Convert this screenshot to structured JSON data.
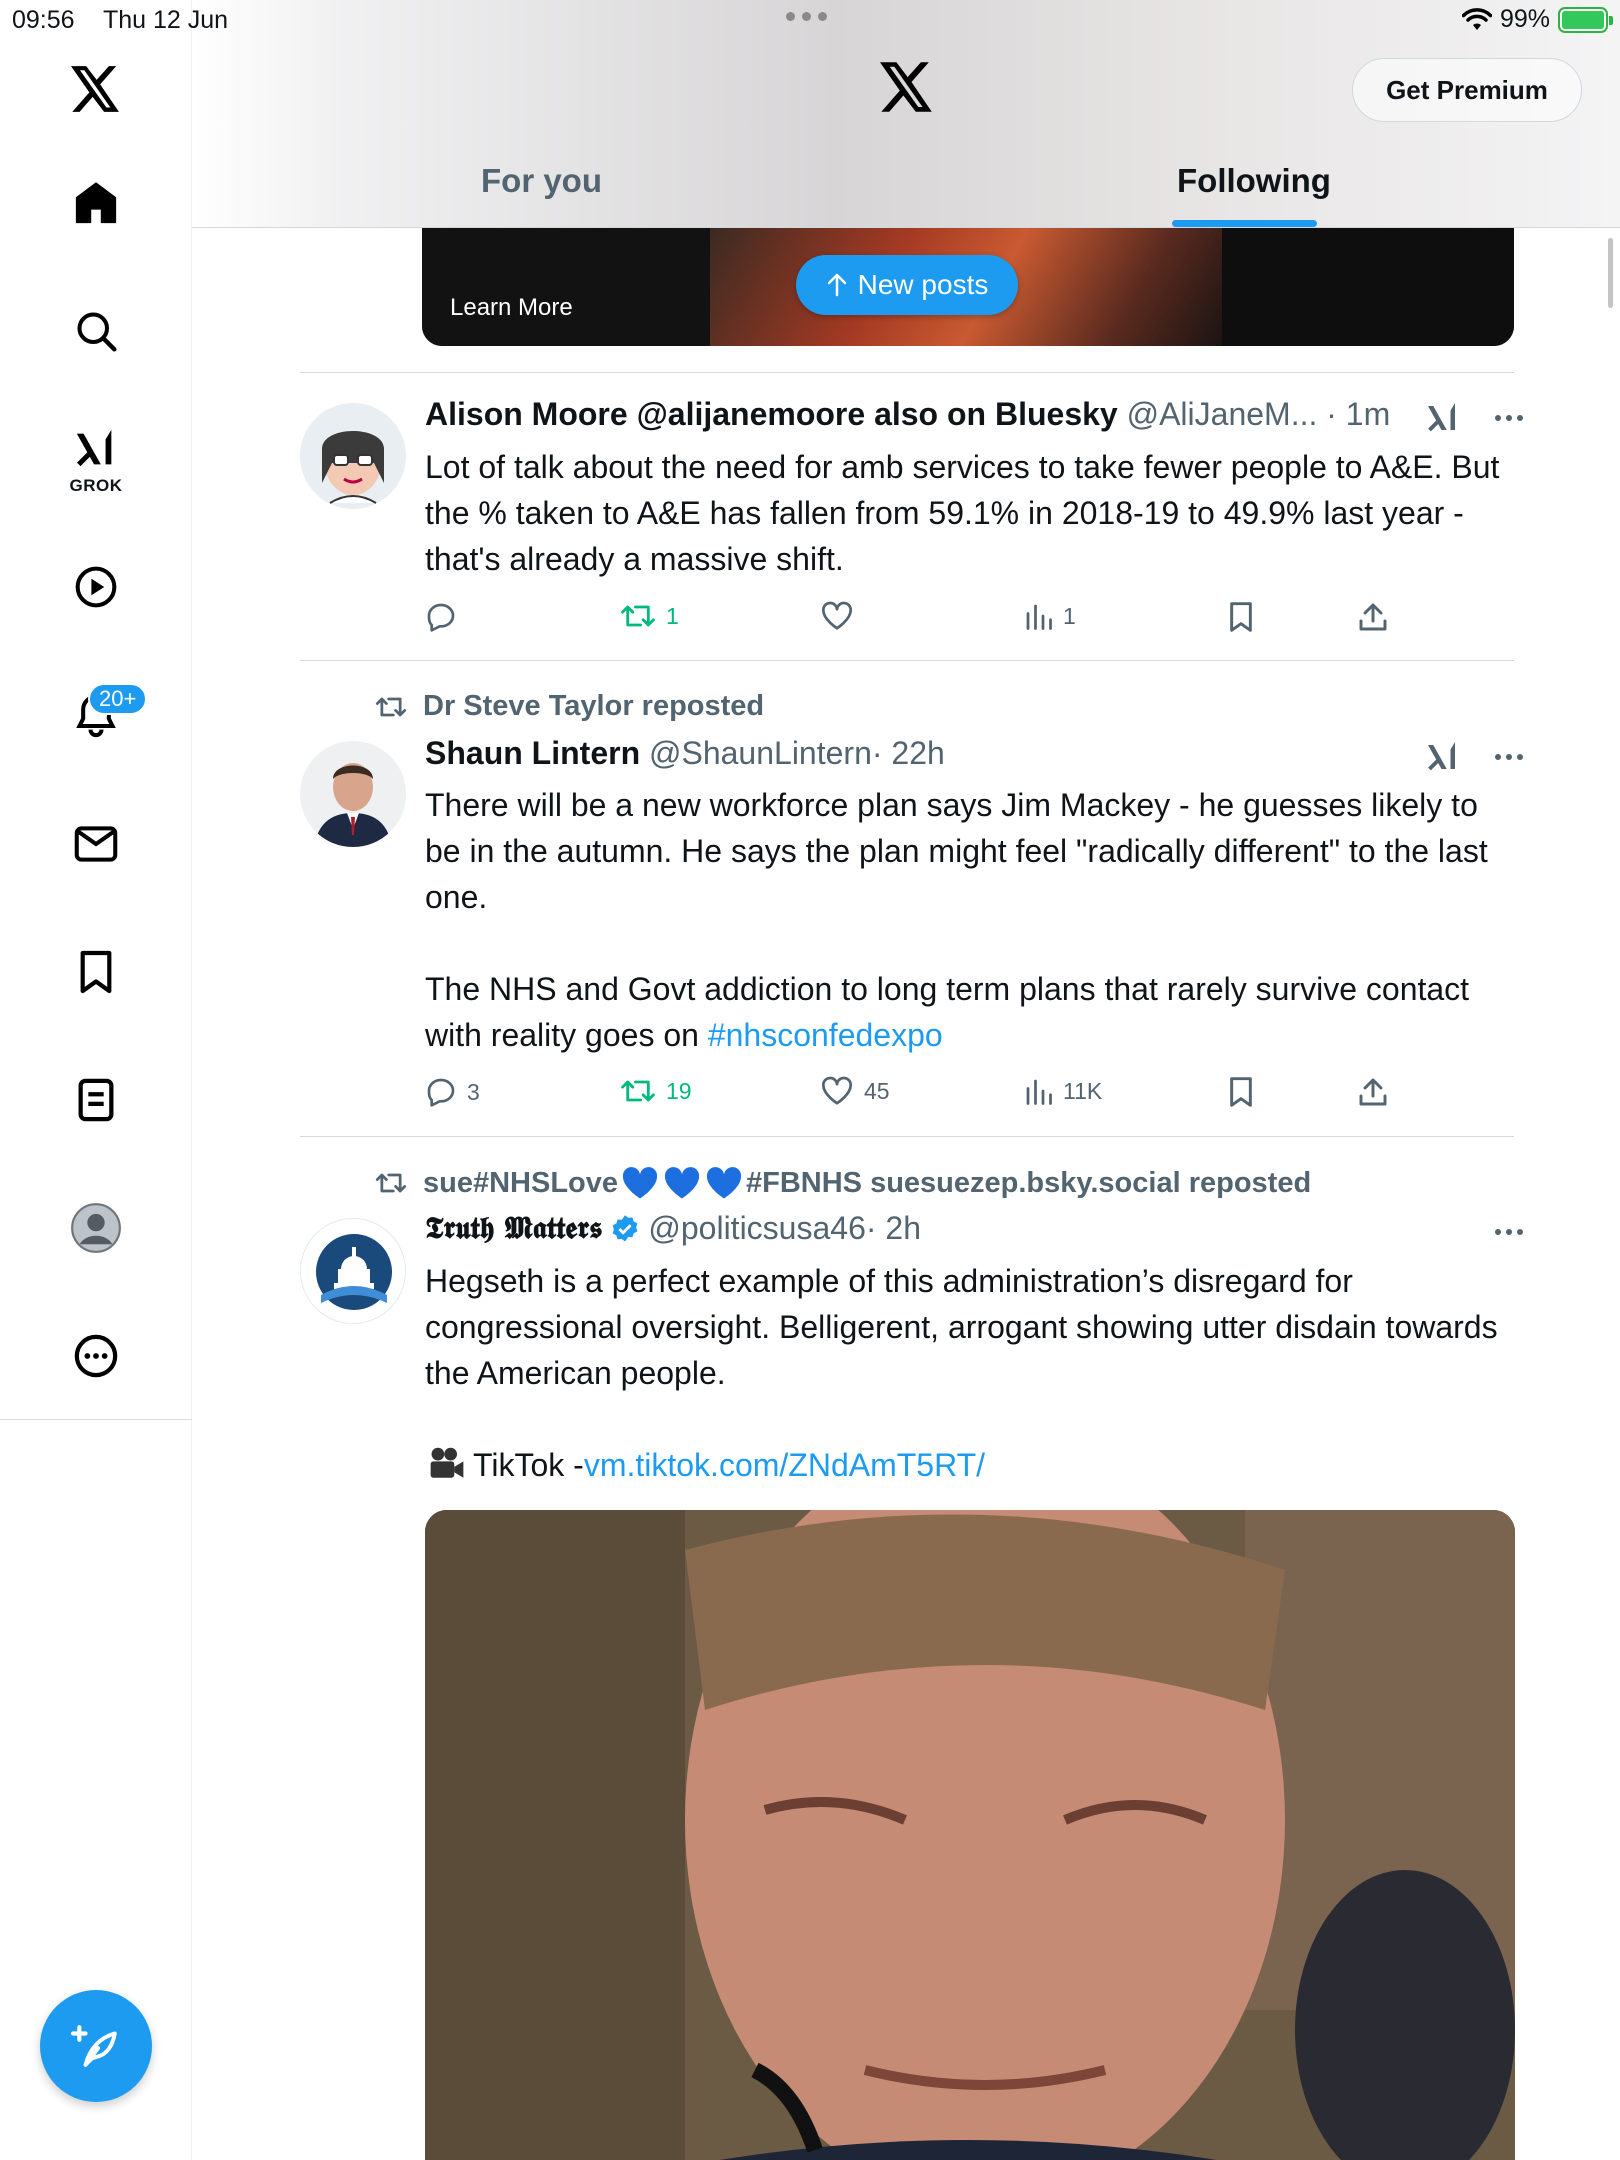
{
  "status_bar": {
    "time": "09:56",
    "date": "Thu 12 Jun",
    "battery": "99%"
  },
  "sidebar": {
    "grok_label": "GROK",
    "notifications_badge": "20+",
    "items": [
      "x-logo",
      "home",
      "explore",
      "grok",
      "video",
      "notifications",
      "messages",
      "bookmarks",
      "lists",
      "profile",
      "more"
    ]
  },
  "header": {
    "premium_label": "Get Premium",
    "tabs": [
      {
        "label": "For you",
        "active": false
      },
      {
        "label": "Following",
        "active": true
      }
    ]
  },
  "feed": {
    "ad": {
      "learn_more": "Learn More"
    },
    "new_posts_label": "New posts",
    "tweets": [
      {
        "name": "Alison Moore @alijanemoore also on Bluesky",
        "handle": "@AliJaneM...",
        "time": "· 1m",
        "body": "Lot of talk about the need for amb services to take fewer people to A&E. But the % taken to A&E has fallen from 59.1% in 2018-19 to 49.9% last year - that's already a massive shift.",
        "replies": "",
        "reposts": "1",
        "likes": "",
        "views": "1"
      },
      {
        "repost_by": "Dr Steve Taylor reposted",
        "name": "Shaun Lintern",
        "handle": "@ShaunLintern",
        "time": "· 22h",
        "body_p1": "There will be a new workforce plan says Jim Mackey - he guesses likely to be in the autumn. He says the plan might feel \"radically different\" to the last one.",
        "body_p2": "The NHS and Govt addiction to long term plans that rarely survive contact with reality goes on ",
        "hashtag": "#nhsconfedexpo",
        "replies": "3",
        "reposts": "19",
        "likes": "45",
        "views": "11K"
      },
      {
        "repost_by_a": "sue#NHSLove",
        "repost_by_b": "#FBNHS suesuezep.bsky.social reposted",
        "name": "𝕿𝖗𝖚𝖙𝖍 𝕸𝖆𝖙𝖙𝖊𝖗𝖘",
        "handle": "@politicsusa46",
        "time": "· 2h",
        "body": "Hegseth is a perfect example of this administration’s disregard for congressional oversight. Belligerent, arrogant showing utter disdain towards the American people.",
        "tiktok_label": "TikTok - ",
        "tiktok_link": "vm.tiktok.com/ZNdAmT5RT/"
      }
    ]
  },
  "colors": {
    "accent": "#1d9bf0",
    "repost_green": "#00ba7c",
    "muted": "#536471"
  }
}
